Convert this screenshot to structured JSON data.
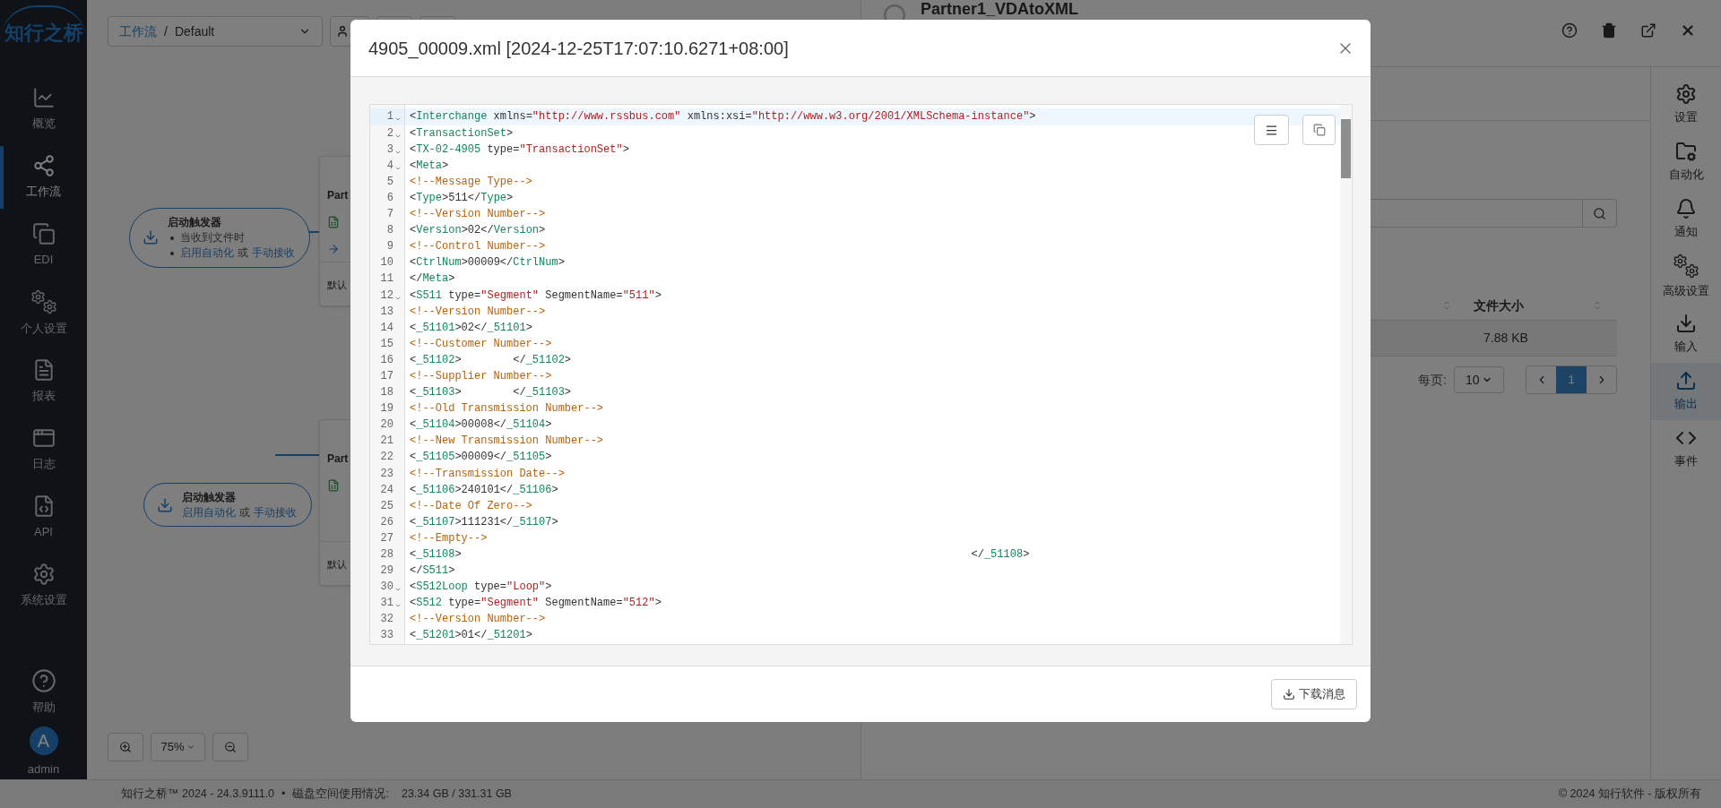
{
  "sidebar": {
    "logo": "知行之桥",
    "items": [
      {
        "label": "概览",
        "selected": false
      },
      {
        "label": "工作流",
        "selected": true
      },
      {
        "label": "EDI",
        "selected": false
      },
      {
        "label": "个人设置",
        "selected": false
      },
      {
        "label": "报表",
        "selected": false
      },
      {
        "label": "日志",
        "selected": false
      },
      {
        "label": "API",
        "selected": false
      },
      {
        "label": "系统设置",
        "selected": false
      }
    ],
    "help": "帮助",
    "user": {
      "initial": "A",
      "name": "admin"
    }
  },
  "canvas": {
    "breadcrumb": {
      "root": "工作流",
      "separator": "/",
      "current": "Default"
    },
    "triggers": [
      {
        "title": "启动触发器",
        "lines": [
          {
            "bullet": true,
            "parts": [
              {
                "text": "当收到文件时",
                "link": false
              }
            ]
          },
          {
            "bullet": true,
            "parts": [
              {
                "text": "启用自动化",
                "link": true
              },
              {
                "text": "或",
                "link": false
              },
              {
                "text": "手动接收",
                "link": true
              }
            ]
          }
        ]
      },
      {
        "title": "启动触发器",
        "lines": [
          {
            "bullet": false,
            "parts": [
              {
                "text": "启用自动化",
                "link": true
              },
              {
                "text": "或",
                "link": false
              },
              {
                "text": "手动接收",
                "link": true
              }
            ]
          }
        ]
      }
    ],
    "cards": [
      {
        "title": "Part",
        "footer": "默认"
      },
      {
        "title": "Part",
        "footer": "默认"
      }
    ],
    "zoom": "75%"
  },
  "panel": {
    "title": "Partner1_VDAtoXML",
    "side_items": [
      {
        "label": "设置",
        "selected": false
      },
      {
        "label": "自动化",
        "selected": false
      },
      {
        "label": "通知",
        "selected": false
      },
      {
        "label": "高级设置",
        "selected": false
      },
      {
        "label": "输入",
        "selected": false
      },
      {
        "label": "输出",
        "selected": true
      },
      {
        "label": "事件",
        "selected": false
      }
    ],
    "table": {
      "columns": [
        "文件大小"
      ],
      "rows": [
        [
          "7.88 KB"
        ]
      ]
    },
    "pagination": {
      "per_page_label": "每页:",
      "per_page": "10",
      "pages": [
        {
          "label": "1",
          "selected": true
        }
      ]
    }
  },
  "modal": {
    "title": "4905_00009.xml [2024-12-25T17:07:10.6271+08:00]",
    "download_button": "下载消息",
    "lines": [
      {
        "number": "1",
        "foldable": true,
        "active": true,
        "tokens": [
          {
            "kind": "plain",
            "text": "<"
          },
          {
            "kind": "tag",
            "text": "Interchange"
          },
          {
            "kind": "plain",
            "text": " xmlns="
          },
          {
            "kind": "string",
            "text": "\"http://www.rssbus.com\""
          },
          {
            "kind": "plain",
            "text": " xmlns:xsi="
          },
          {
            "kind": "string",
            "text": "\"http://www.w3.org/2001/XMLSchema-instance\""
          },
          {
            "kind": "plain",
            "text": ">"
          }
        ]
      },
      {
        "number": "2",
        "foldable": true,
        "active": false,
        "tokens": [
          {
            "kind": "plain",
            "text": "<"
          },
          {
            "kind": "tag",
            "text": "TransactionSet"
          },
          {
            "kind": "plain",
            "text": ">"
          }
        ]
      },
      {
        "number": "3",
        "foldable": true,
        "active": false,
        "tokens": [
          {
            "kind": "plain",
            "text": "<"
          },
          {
            "kind": "tag",
            "text": "TX-02-4905"
          },
          {
            "kind": "plain",
            "text": " type="
          },
          {
            "kind": "string",
            "text": "\"TransactionSet\""
          },
          {
            "kind": "plain",
            "text": ">"
          }
        ]
      },
      {
        "number": "4",
        "foldable": true,
        "active": false,
        "tokens": [
          {
            "kind": "plain",
            "text": "<"
          },
          {
            "kind": "tag",
            "text": "Meta"
          },
          {
            "kind": "plain",
            "text": ">"
          }
        ]
      },
      {
        "number": "5",
        "foldable": false,
        "active": false,
        "tokens": [
          {
            "kind": "comment",
            "text": "<!--Message Type-->"
          }
        ]
      },
      {
        "number": "6",
        "foldable": false,
        "active": false,
        "tokens": [
          {
            "kind": "plain",
            "text": "<"
          },
          {
            "kind": "tag",
            "text": "Type"
          },
          {
            "kind": "plain",
            "text": ">511</"
          },
          {
            "kind": "tag",
            "text": "Type"
          },
          {
            "kind": "plain",
            "text": ">"
          }
        ]
      },
      {
        "number": "7",
        "foldable": false,
        "active": false,
        "tokens": [
          {
            "kind": "comment",
            "text": "<!--Version Number-->"
          }
        ]
      },
      {
        "number": "8",
        "foldable": false,
        "active": false,
        "tokens": [
          {
            "kind": "plain",
            "text": "<"
          },
          {
            "kind": "tag",
            "text": "Version"
          },
          {
            "kind": "plain",
            "text": ">02</"
          },
          {
            "kind": "tag",
            "text": "Version"
          },
          {
            "kind": "plain",
            "text": ">"
          }
        ]
      },
      {
        "number": "9",
        "foldable": false,
        "active": false,
        "tokens": [
          {
            "kind": "comment",
            "text": "<!--Control Number-->"
          }
        ]
      },
      {
        "number": "10",
        "foldable": false,
        "active": false,
        "tokens": [
          {
            "kind": "plain",
            "text": "<"
          },
          {
            "kind": "tag",
            "text": "CtrlNum"
          },
          {
            "kind": "plain",
            "text": ">00009</"
          },
          {
            "kind": "tag",
            "text": "CtrlNum"
          },
          {
            "kind": "plain",
            "text": ">"
          }
        ]
      },
      {
        "number": "11",
        "foldable": false,
        "active": false,
        "tokens": [
          {
            "kind": "plain",
            "text": "</"
          },
          {
            "kind": "tag",
            "text": "Meta"
          },
          {
            "kind": "plain",
            "text": ">"
          }
        ]
      },
      {
        "number": "12",
        "foldable": true,
        "active": false,
        "tokens": [
          {
            "kind": "plain",
            "text": "<"
          },
          {
            "kind": "tag",
            "text": "S511"
          },
          {
            "kind": "plain",
            "text": " type="
          },
          {
            "kind": "string",
            "text": "\"Segment\""
          },
          {
            "kind": "plain",
            "text": " SegmentName="
          },
          {
            "kind": "string",
            "text": "\"511\""
          },
          {
            "kind": "plain",
            "text": ">"
          }
        ]
      },
      {
        "number": "13",
        "foldable": false,
        "active": false,
        "tokens": [
          {
            "kind": "comment",
            "text": "<!--Version Number-->"
          }
        ]
      },
      {
        "number": "14",
        "foldable": false,
        "active": false,
        "tokens": [
          {
            "kind": "plain",
            "text": "<"
          },
          {
            "kind": "tag",
            "text": "_51101"
          },
          {
            "kind": "plain",
            "text": ">02</"
          },
          {
            "kind": "tag",
            "text": "_51101"
          },
          {
            "kind": "plain",
            "text": ">"
          }
        ]
      },
      {
        "number": "15",
        "foldable": false,
        "active": false,
        "tokens": [
          {
            "kind": "comment",
            "text": "<!--Customer Number-->"
          }
        ]
      },
      {
        "number": "16",
        "foldable": false,
        "active": false,
        "tokens": [
          {
            "kind": "plain",
            "text": "<"
          },
          {
            "kind": "tag",
            "text": "_51102"
          },
          {
            "kind": "plain",
            "text": ">        </"
          },
          {
            "kind": "tag",
            "text": "_51102"
          },
          {
            "kind": "plain",
            "text": ">"
          }
        ]
      },
      {
        "number": "17",
        "foldable": false,
        "active": false,
        "tokens": [
          {
            "kind": "comment",
            "text": "<!--Supplier Number-->"
          }
        ]
      },
      {
        "number": "18",
        "foldable": false,
        "active": false,
        "tokens": [
          {
            "kind": "plain",
            "text": "<"
          },
          {
            "kind": "tag",
            "text": "_51103"
          },
          {
            "kind": "plain",
            "text": ">        </"
          },
          {
            "kind": "tag",
            "text": "_51103"
          },
          {
            "kind": "plain",
            "text": ">"
          }
        ]
      },
      {
        "number": "19",
        "foldable": false,
        "active": false,
        "tokens": [
          {
            "kind": "comment",
            "text": "<!--Old Transmission Number-->"
          }
        ]
      },
      {
        "number": "20",
        "foldable": false,
        "active": false,
        "tokens": [
          {
            "kind": "plain",
            "text": "<"
          },
          {
            "kind": "tag",
            "text": "_51104"
          },
          {
            "kind": "plain",
            "text": ">00008</"
          },
          {
            "kind": "tag",
            "text": "_51104"
          },
          {
            "kind": "plain",
            "text": ">"
          }
        ]
      },
      {
        "number": "21",
        "foldable": false,
        "active": false,
        "tokens": [
          {
            "kind": "comment",
            "text": "<!--New Transmission Number-->"
          }
        ]
      },
      {
        "number": "22",
        "foldable": false,
        "active": false,
        "tokens": [
          {
            "kind": "plain",
            "text": "<"
          },
          {
            "kind": "tag",
            "text": "_51105"
          },
          {
            "kind": "plain",
            "text": ">00009</"
          },
          {
            "kind": "tag",
            "text": "_51105"
          },
          {
            "kind": "plain",
            "text": ">"
          }
        ]
      },
      {
        "number": "23",
        "foldable": false,
        "active": false,
        "tokens": [
          {
            "kind": "comment",
            "text": "<!--Transmission Date-->"
          }
        ]
      },
      {
        "number": "24",
        "foldable": false,
        "active": false,
        "tokens": [
          {
            "kind": "plain",
            "text": "<"
          },
          {
            "kind": "tag",
            "text": "_51106"
          },
          {
            "kind": "plain",
            "text": ">240101</"
          },
          {
            "kind": "tag",
            "text": "_51106"
          },
          {
            "kind": "plain",
            "text": ">"
          }
        ]
      },
      {
        "number": "25",
        "foldable": false,
        "active": false,
        "tokens": [
          {
            "kind": "comment",
            "text": "<!--Date Of Zero-->"
          }
        ]
      },
      {
        "number": "26",
        "foldable": false,
        "active": false,
        "tokens": [
          {
            "kind": "plain",
            "text": "<"
          },
          {
            "kind": "tag",
            "text": "_51107"
          },
          {
            "kind": "plain",
            "text": ">111231</"
          },
          {
            "kind": "tag",
            "text": "_51107"
          },
          {
            "kind": "plain",
            "text": ">"
          }
        ]
      },
      {
        "number": "27",
        "foldable": false,
        "active": false,
        "tokens": [
          {
            "kind": "comment",
            "text": "<!--Empty-->"
          }
        ]
      },
      {
        "number": "28",
        "foldable": false,
        "active": false,
        "tokens": [
          {
            "kind": "plain",
            "text": "<"
          },
          {
            "kind": "tag",
            "text": "_51108"
          },
          {
            "kind": "plain",
            "text": ">                                                                               </"
          },
          {
            "kind": "tag",
            "text": "_51108"
          },
          {
            "kind": "plain",
            "text": ">"
          }
        ]
      },
      {
        "number": "29",
        "foldable": false,
        "active": false,
        "tokens": [
          {
            "kind": "plain",
            "text": "</"
          },
          {
            "kind": "tag",
            "text": "S511"
          },
          {
            "kind": "plain",
            "text": ">"
          }
        ]
      },
      {
        "number": "30",
        "foldable": true,
        "active": false,
        "tokens": [
          {
            "kind": "plain",
            "text": "<"
          },
          {
            "kind": "tag",
            "text": "S512Loop"
          },
          {
            "kind": "plain",
            "text": " type="
          },
          {
            "kind": "string",
            "text": "\"Loop\""
          },
          {
            "kind": "plain",
            "text": ">"
          }
        ]
      },
      {
        "number": "31",
        "foldable": true,
        "active": false,
        "tokens": [
          {
            "kind": "plain",
            "text": "<"
          },
          {
            "kind": "tag",
            "text": "S512"
          },
          {
            "kind": "plain",
            "text": " type="
          },
          {
            "kind": "string",
            "text": "\"Segment\""
          },
          {
            "kind": "plain",
            "text": " SegmentName="
          },
          {
            "kind": "string",
            "text": "\"512\""
          },
          {
            "kind": "plain",
            "text": ">"
          }
        ]
      },
      {
        "number": "32",
        "foldable": false,
        "active": false,
        "tokens": [
          {
            "kind": "comment",
            "text": "<!--Version Number-->"
          }
        ]
      },
      {
        "number": "33",
        "foldable": false,
        "active": false,
        "tokens": [
          {
            "kind": "plain",
            "text": "<"
          },
          {
            "kind": "tag",
            "text": "_51201"
          },
          {
            "kind": "plain",
            "text": ">01</"
          },
          {
            "kind": "tag",
            "text": "_51201"
          },
          {
            "kind": "plain",
            "text": ">"
          }
        ]
      }
    ]
  },
  "status_bar": {
    "version": "知行之桥™ 2024 - 24.3.9111.0",
    "separator": "•",
    "disk_label": "磁盘空间使用情况:",
    "disk_usage": "23.34 GB / 331.31 GB",
    "copyright": "© 2024 知行软件 - 版权所有"
  }
}
